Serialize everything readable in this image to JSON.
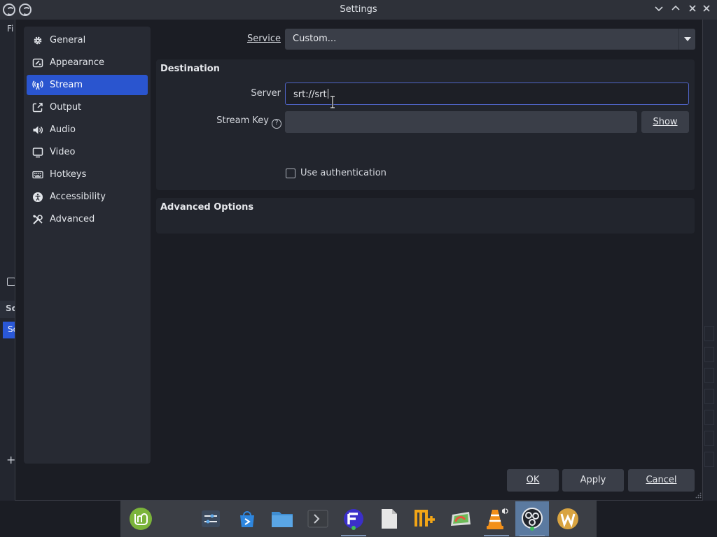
{
  "window": {
    "title": "Settings"
  },
  "background": {
    "menu_initial": "Fi",
    "scenes_tab_label": "Sc",
    "scene_item_label": "Sc"
  },
  "sidebar": {
    "items": [
      {
        "label": "General",
        "icon": "gear-icon",
        "active": false
      },
      {
        "label": "Appearance",
        "icon": "palette-icon",
        "active": false
      },
      {
        "label": "Stream",
        "icon": "broadcast-icon",
        "active": true
      },
      {
        "label": "Output",
        "icon": "output-icon",
        "active": false
      },
      {
        "label": "Audio",
        "icon": "speaker-icon",
        "active": false
      },
      {
        "label": "Video",
        "icon": "monitor-icon",
        "active": false
      },
      {
        "label": "Hotkeys",
        "icon": "keyboard-icon",
        "active": false
      },
      {
        "label": "Accessibility",
        "icon": "accessibility-icon",
        "active": false
      },
      {
        "label": "Advanced",
        "icon": "tools-icon",
        "active": false
      }
    ]
  },
  "service": {
    "label": "Service",
    "value": "Custom..."
  },
  "destination": {
    "title": "Destination",
    "server_label": "Server",
    "server_value": "srt://srt",
    "stream_key_label": "Stream Key",
    "stream_key_value": "",
    "show_label": "Show",
    "use_auth_label": "Use authentication",
    "use_auth_checked": false
  },
  "advanced": {
    "title": "Advanced Options"
  },
  "buttons": {
    "ok": "OK",
    "apply": "Apply",
    "cancel": "Cancel"
  },
  "taskbar": {
    "apps": [
      "mint-menu-icon",
      "settings-icon",
      "software-manager-icon",
      "files-icon",
      "terminal-icon",
      "foss-app-icon",
      "text-editor-icon",
      "nemo-icon",
      "disk-usage-icon",
      "vlc-icon",
      "obs-icon",
      "w-app-icon"
    ]
  },
  "colors": {
    "accent": "#2a55cf",
    "dialog_bg": "#1b1d24",
    "sidebar_bg": "#272a33",
    "input_bg": "#3a3e48"
  }
}
